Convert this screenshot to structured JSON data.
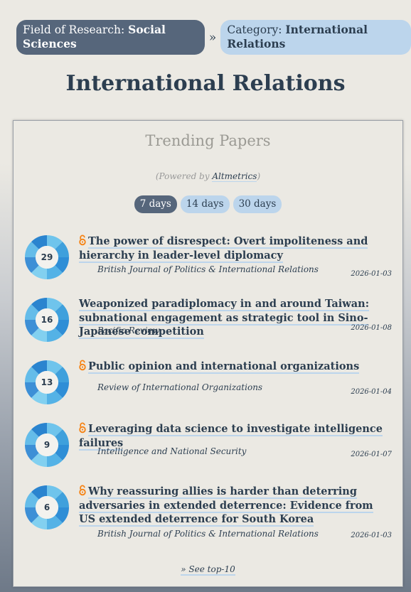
{
  "breadcrumb": {
    "field_prefix": "Field of Research: ",
    "field_value": "Social Sciences",
    "separator": "»",
    "category_prefix": "Category: ",
    "category_value": "International Relations"
  },
  "page_title": "International Relations",
  "card": {
    "title": "Trending Papers",
    "powered_prefix": "(Powered by ",
    "powered_link": "Altmetrics",
    "powered_suffix": ")",
    "tabs": [
      {
        "label": "7 days",
        "active": true
      },
      {
        "label": "14 days",
        "active": false
      },
      {
        "label": "30 days",
        "active": false
      }
    ],
    "papers": [
      {
        "score": "29",
        "open_access": true,
        "title": "The power of disrespect: Overt impoliteness and hierarchy in leader-level diplomacy",
        "journal": "British Journal of Politics & International Relations",
        "date": "2026-01-03"
      },
      {
        "score": "16",
        "open_access": false,
        "title": "Weaponized paradiplomacy in and around Taiwan: subnational engagement as strategic tool in Sino-Japanese competition",
        "journal": "Pacific Review",
        "date": "2026-01-08"
      },
      {
        "score": "13",
        "open_access": true,
        "title": "Public opinion and international organizations",
        "journal": "Review of International Organizations",
        "date": "2026-01-04"
      },
      {
        "score": "9",
        "open_access": true,
        "title": "Leveraging data science to investigate intelligence failures",
        "journal": "Intelligence and National Security",
        "date": "2026-01-07"
      },
      {
        "score": "6",
        "open_access": true,
        "title": "Why reassuring allies is harder than deterring adversaries in extended deterrence: Evidence from US extended deterrence for South Korea",
        "journal": "British Journal of Politics & International Relations",
        "date": "2026-01-03"
      }
    ],
    "see_more": "» See top-10"
  },
  "colors": {
    "dark_pill": "#56667b",
    "light_pill": "#bcd5ec",
    "text": "#2c3e50",
    "open_access": "#f68212",
    "altmetric_blue": "#3d8fd6"
  },
  "icons": {
    "open_access": "open-access-lock-icon",
    "score": "altmetric-donut-icon"
  }
}
